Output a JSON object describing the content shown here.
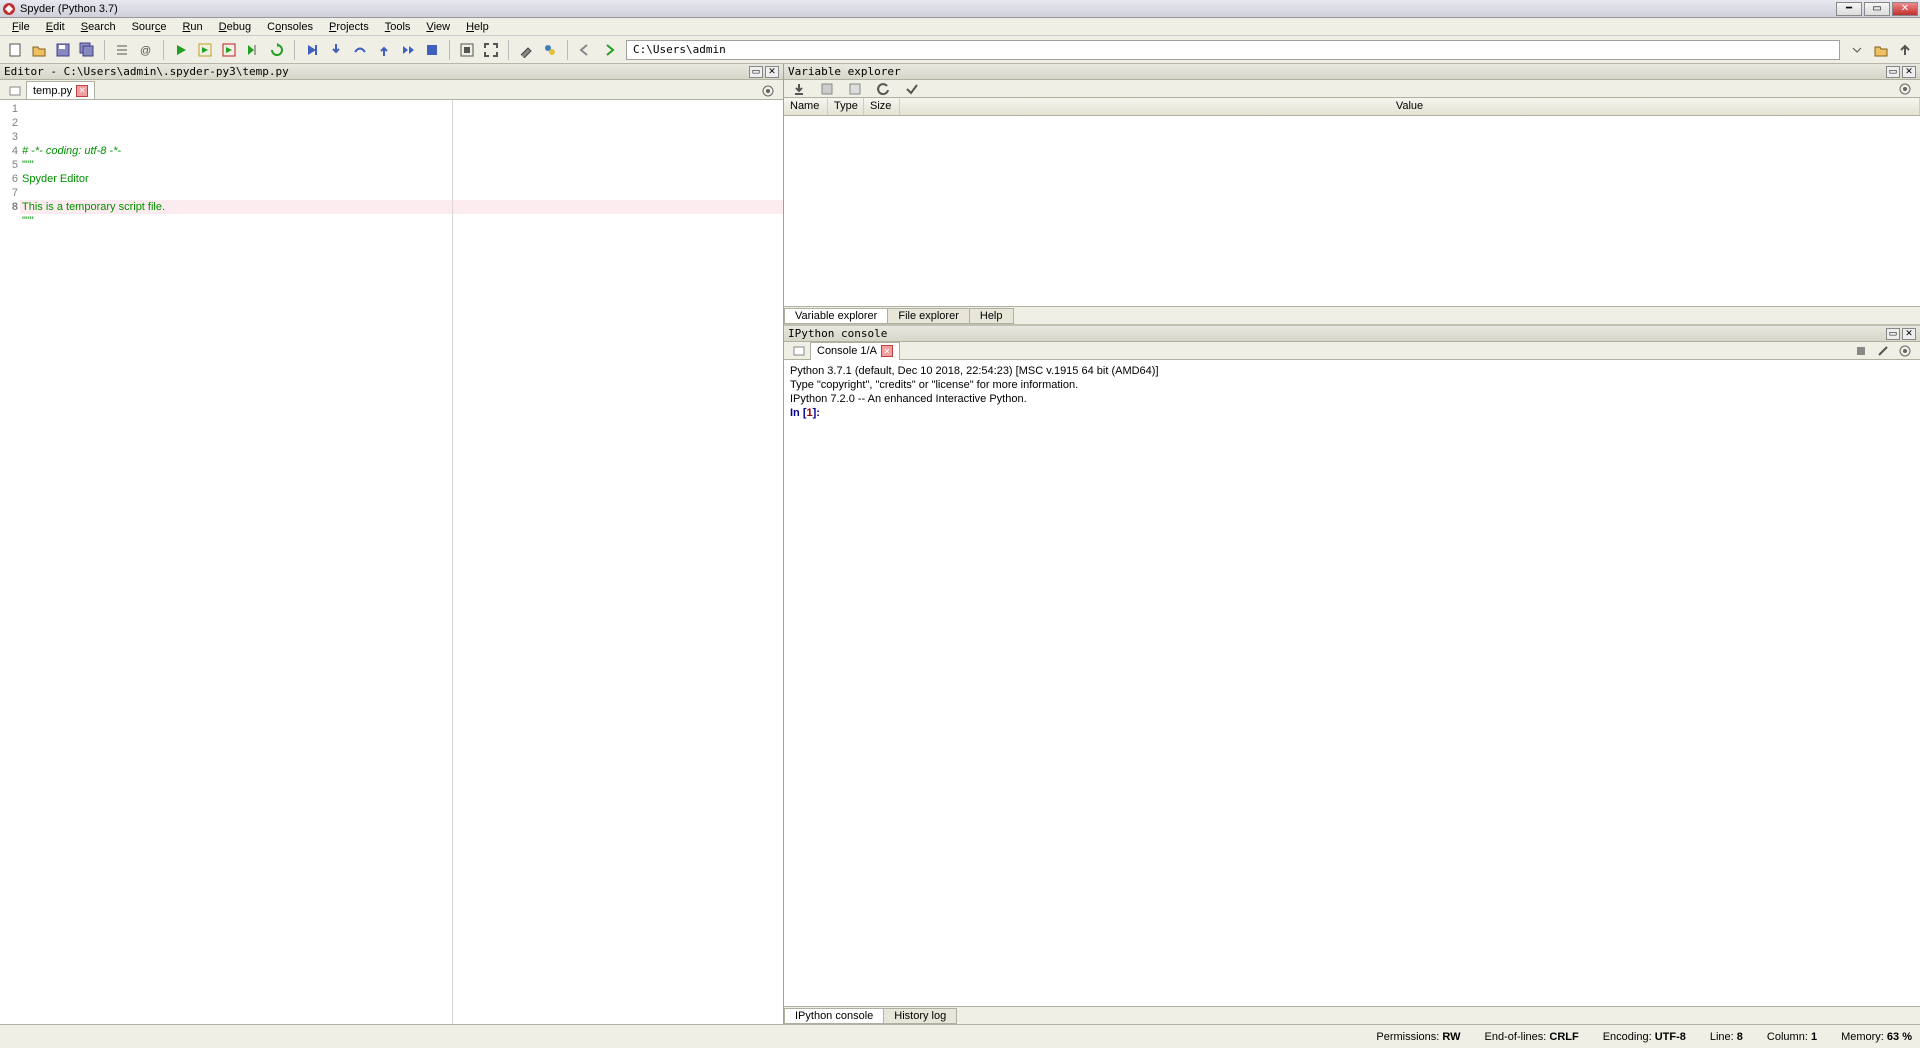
{
  "title": "Spyder (Python 3.7)",
  "menus": [
    "File",
    "Edit",
    "Search",
    "Source",
    "Run",
    "Debug",
    "Consoles",
    "Projects",
    "Tools",
    "View",
    "Help"
  ],
  "working_dir": "C:\\Users\\admin",
  "editor_title": "Editor - C:\\Users\\admin\\.spyder-py3\\temp.py",
  "editor_tab": "temp.py",
  "code_lines": [
    {
      "n": "1",
      "cls": "greenital",
      "t": "# -*- coding: utf-8 -*-"
    },
    {
      "n": "2",
      "cls": "green",
      "t": "\"\"\""
    },
    {
      "n": "3",
      "cls": "green",
      "t": "Spyder Editor"
    },
    {
      "n": "4",
      "cls": "green",
      "t": ""
    },
    {
      "n": "5",
      "cls": "green",
      "t": "This is a temporary script file."
    },
    {
      "n": "6",
      "cls": "green",
      "t": "\"\"\""
    },
    {
      "n": "7",
      "cls": "",
      "t": ""
    },
    {
      "n": "8",
      "cls": "",
      "t": ""
    }
  ],
  "varexp_title": "Variable explorer",
  "var_headers": {
    "name": "Name",
    "type": "Type",
    "size": "Size",
    "value": "Value"
  },
  "right_tabs": {
    "var": "Variable explorer",
    "file": "File explorer",
    "help": "Help"
  },
  "ipy_title": "IPython console",
  "console_tab": "Console 1/A",
  "console_lines": [
    "Python 3.7.1 (default, Dec 10 2018, 22:54:23) [MSC v.1915 64 bit (AMD64)]",
    "Type \"copyright\", \"credits\" or \"license\" for more information.",
    "",
    "IPython 7.2.0 -- An enhanced Interactive Python.",
    ""
  ],
  "prompt_in": "In [",
  "prompt_num": "1",
  "prompt_close": "]:",
  "bottom_tabs": {
    "ipy": "IPython console",
    "hist": "History log"
  },
  "status": {
    "perm_label": "Permissions:",
    "perm": "RW",
    "eol_label": "End-of-lines:",
    "eol": "CRLF",
    "enc_label": "Encoding:",
    "enc": "UTF-8",
    "line_label": "Line:",
    "line": "8",
    "col_label": "Column:",
    "col": "1",
    "mem_label": "Memory:",
    "mem": "63 %"
  }
}
